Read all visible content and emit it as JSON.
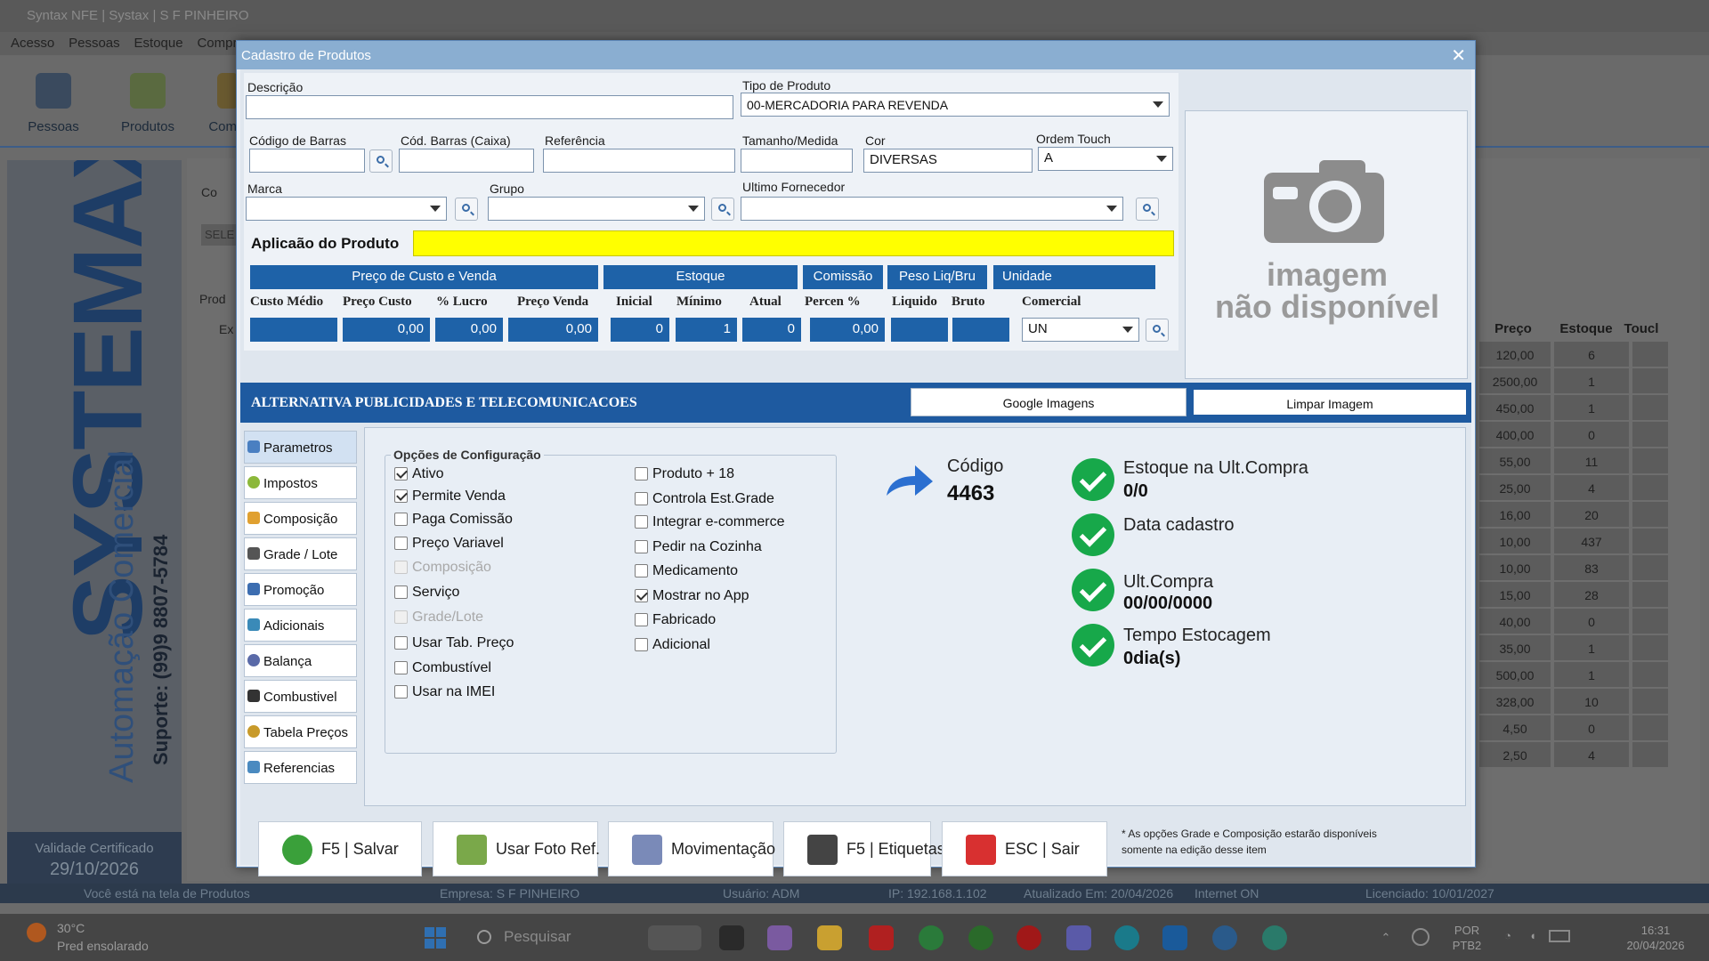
{
  "background": {
    "title": "Syntax NFE | Systax | S F PINHEIRO",
    "menu": [
      "Acesso",
      "Pessoas",
      "Estoque",
      "Compras"
    ],
    "toolbar": [
      {
        "label": "Pessoas",
        "icon": "people-icon"
      },
      {
        "label": "Produtos",
        "icon": "cart-icon"
      },
      {
        "label": "Com",
        "icon": "shop-icon"
      }
    ],
    "brand": {
      "main": "SYSTEMAX",
      "sub": "Automação Comercial",
      "support": "Suporte: (99)9 8807-5784"
    },
    "certificate": {
      "label": "Validade Certificado",
      "date": "29/10/2026"
    },
    "filter_label": "Co",
    "select_placeholder": "SELE",
    "products_label": "Prod",
    "grid_prefix": "Ex",
    "grid": {
      "headers": [
        "Preço",
        "Estoque",
        "Toucl"
      ],
      "rows": [
        [
          "120,00",
          "6"
        ],
        [
          "2500,00",
          "1"
        ],
        [
          "450,00",
          "1"
        ],
        [
          "400,00",
          "0"
        ],
        [
          "55,00",
          "11"
        ],
        [
          "25,00",
          "4"
        ],
        [
          "16,00",
          "20"
        ],
        [
          "10,00",
          "437"
        ],
        [
          "10,00",
          "83"
        ],
        [
          "15,00",
          "28"
        ],
        [
          "40,00",
          "0"
        ],
        [
          "35,00",
          "1"
        ],
        [
          "500,00",
          "1"
        ],
        [
          "328,00",
          "10"
        ],
        [
          "4,50",
          "0"
        ],
        [
          "2,50",
          "4"
        ]
      ]
    },
    "status": {
      "screen": "Você está na tela de Produtos",
      "company": "Empresa: S F PINHEIRO",
      "user": "Usuário: ADM",
      "ip": "IP: 192.168.1.102",
      "updated": "Atualizado Em: 20/04/2026",
      "internet": "Internet ON",
      "license": "Licenciado: 10/01/2027"
    }
  },
  "modal": {
    "title": "Cadastro de Produtos",
    "fields": {
      "descricao": {
        "label": "Descrição",
        "value": ""
      },
      "tipo_produto": {
        "label": "Tipo de Produto",
        "value": "00-MERCADORIA PARA REVENDA"
      },
      "codigo_barras": {
        "label": "Código de Barras",
        "value": ""
      },
      "cod_barras_caixa": {
        "label": "Cód. Barras (Caixa)",
        "value": ""
      },
      "referencia": {
        "label": "Referência",
        "value": ""
      },
      "tamanho": {
        "label": "Tamanho/Medida",
        "value": ""
      },
      "cor": {
        "label": "Cor",
        "value": "DIVERSAS"
      },
      "ordem_touch": {
        "label": "Ordem Touch",
        "value": "A"
      },
      "marca": {
        "label": "Marca",
        "value": ""
      },
      "grupo": {
        "label": "Grupo",
        "value": ""
      },
      "ultimo_fornecedor": {
        "label": "Ultimo Fornecedor",
        "value": ""
      },
      "aplicacao": {
        "label": "Aplicaão do Produto",
        "value": ""
      }
    },
    "price_headers": {
      "custo_venda": "Preço de Custo e Venda",
      "estoque": "Estoque",
      "comissao": "Comissão",
      "peso": "Peso Liq/Bru",
      "unidade": "Unidade"
    },
    "price_subheaders": {
      "custo_medio": "Custo Médio",
      "preco_custo": "Preço Custo",
      "lucro": "% Lucro",
      "preco_venda": "Preço Venda",
      "inicial": "Inicial",
      "minimo": "Mínimo",
      "atual": "Atual",
      "percen": "Percen %",
      "liquido": "Liquido",
      "bruto": "Bruto",
      "comercial": "Comercial"
    },
    "price_values": {
      "custo_medio": "",
      "preco_custo": "0,00",
      "lucro": "0,00",
      "preco_venda": "0,00",
      "inicial": "0",
      "minimo": "1",
      "atual": "0",
      "percen": "0,00",
      "liquido": "",
      "bruto": "",
      "unidade": "UN"
    },
    "image": {
      "line1": "imagem",
      "line2": "não disponível"
    },
    "company": "ALTERNATIVA PUBLICIDADES E TELECOMUNICACOES",
    "google_button": "Google Imagens",
    "clear_button": "Limpar Imagem",
    "nav": [
      {
        "label": "Parametros",
        "icon": "settings-icon",
        "color": "#4a7fc1",
        "active": true
      },
      {
        "label": "Impostos",
        "icon": "coin-icon",
        "color": "#8cb83a"
      },
      {
        "label": "Composição",
        "icon": "composition-icon",
        "color": "#e0a030"
      },
      {
        "label": "Grade / Lote",
        "icon": "grid-icon",
        "color": "#555555"
      },
      {
        "label": "Promoção",
        "icon": "tag-icon",
        "color": "#3c6db0"
      },
      {
        "label": "Adicionais",
        "icon": "list-icon",
        "color": "#3a8ab8"
      },
      {
        "label": "Balança",
        "icon": "scale-icon",
        "color": "#5a6aa8"
      },
      {
        "label": "Combustivel",
        "icon": "fuel-icon",
        "color": "#333333"
      },
      {
        "label": "Tabela Preços",
        "icon": "price-table-icon",
        "color": "#c89a2a"
      },
      {
        "label": "Referencias",
        "icon": "reference-icon",
        "color": "#4a8ac0"
      }
    ],
    "config": {
      "title": "Opções de Configuração",
      "left": [
        {
          "label": "Ativo",
          "checked": true
        },
        {
          "label": "Permite Venda",
          "checked": true
        },
        {
          "label": "Paga Comissão",
          "checked": false
        },
        {
          "label": "Preço Variavel",
          "checked": false
        },
        {
          "label": "Composição",
          "checked": false,
          "disabled": true
        },
        {
          "label": "Serviço",
          "checked": false
        },
        {
          "label": "Grade/Lote",
          "checked": false,
          "disabled": true
        },
        {
          "label": "Usar Tab. Preço",
          "checked": false
        },
        {
          "label": "Combustível",
          "checked": false
        },
        {
          "label": "Usar na IMEI",
          "checked": false
        }
      ],
      "right": [
        {
          "label": "Produto + 18",
          "checked": false
        },
        {
          "label": "Controla Est.Grade",
          "checked": false
        },
        {
          "label": "Integrar e-commerce",
          "checked": false
        },
        {
          "label": "Pedir na Cozinha",
          "checked": false
        },
        {
          "label": "Medicamento",
          "checked": false
        },
        {
          "label": "Mostrar no App",
          "checked": true
        },
        {
          "label": "Fabricado",
          "checked": false
        },
        {
          "label": "Adicional",
          "checked": false
        }
      ]
    },
    "codigo": {
      "label": "Código",
      "value": "4463"
    },
    "stats": [
      {
        "label": "Estoque na Ult.Compra",
        "value": "0/0"
      },
      {
        "label": "Data cadastro",
        "value": ""
      },
      {
        "label": "Ult.Compra",
        "value": "00/00/0000"
      },
      {
        "label": "Tempo Estocagem",
        "value": "0dia(s)"
      }
    ],
    "buttons": [
      {
        "label": "F5 | Salvar",
        "icon": "check-icon",
        "color": "#3aa03a"
      },
      {
        "label": "Usar Foto Ref.",
        "icon": "photo-icon",
        "color": "#7aa84a"
      },
      {
        "label": "Movimentação",
        "icon": "chart-icon",
        "color": "#7a8ab8"
      },
      {
        "label": "F5 | Etiquetas",
        "icon": "barcode-icon",
        "color": "#444444"
      },
      {
        "label": "ESC | Sair",
        "icon": "close-icon",
        "color": "#d83030"
      }
    ],
    "note": "* As opções Grade e Composição estarão disponíveis somente na edição desse item"
  },
  "taskbar": {
    "temperature": "30°C",
    "weather": "Pred ensolarado",
    "search": "Pesquisar",
    "lang1": "POR",
    "lang2": "PTB2",
    "time": "16:31",
    "date": "20/04/2026"
  }
}
